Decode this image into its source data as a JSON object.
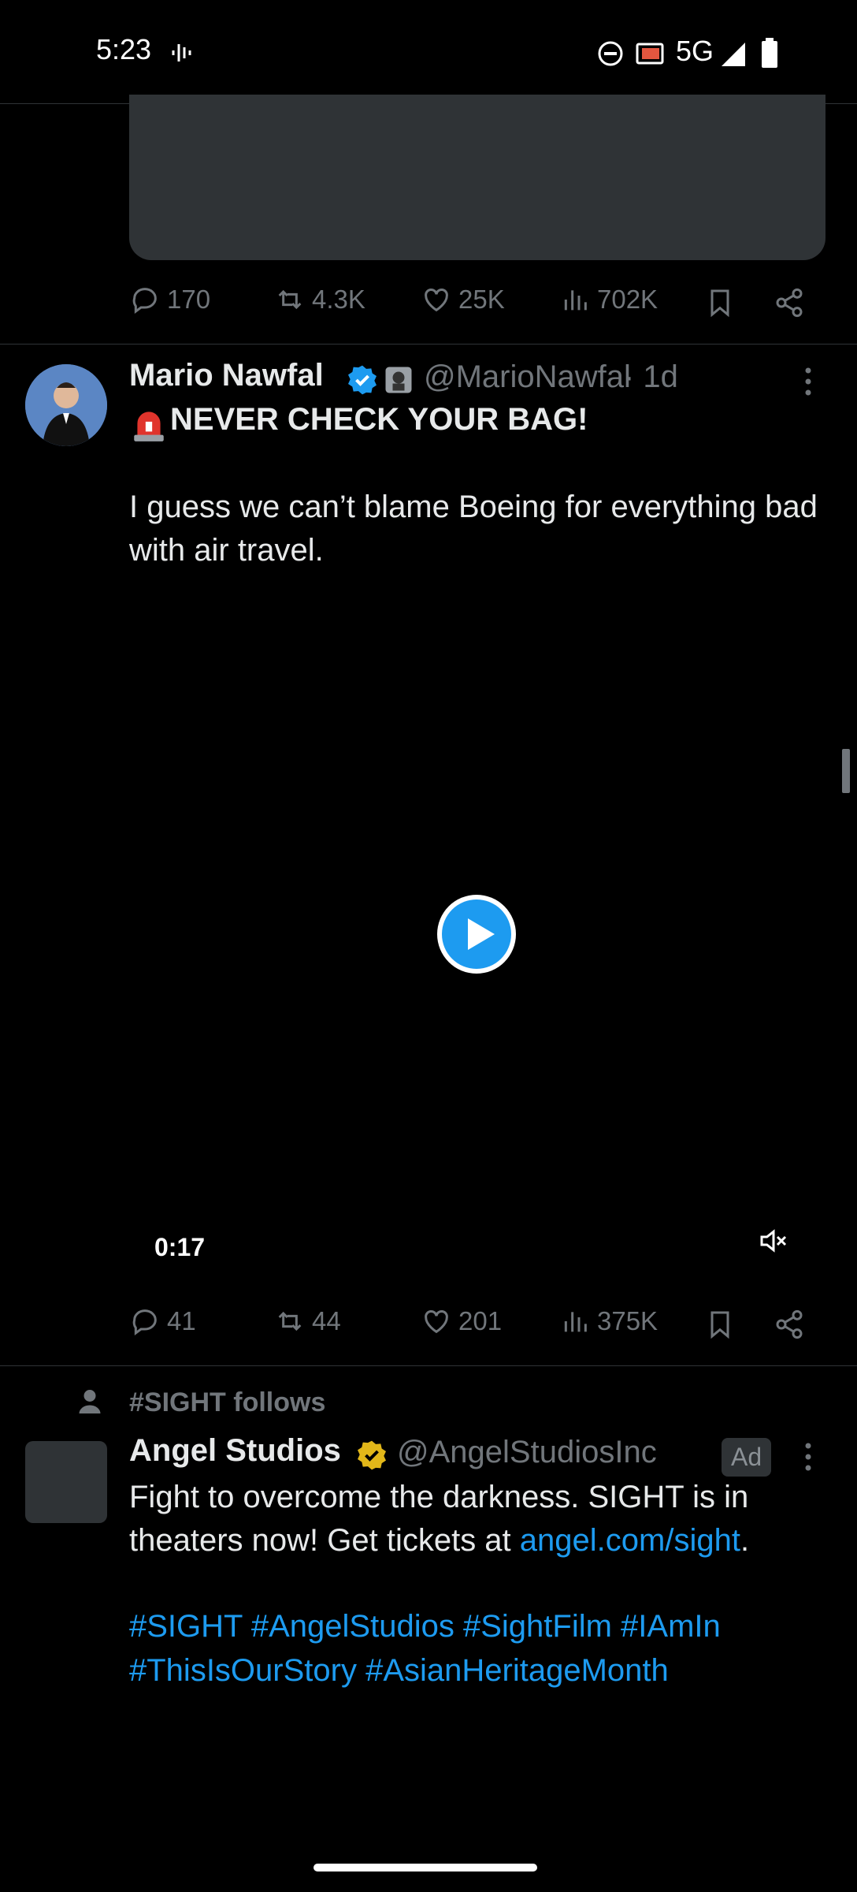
{
  "status": {
    "time": "5:23",
    "network": "5G"
  },
  "post1": {
    "replies": "170",
    "reposts": "4.3K",
    "likes": "25K",
    "views": "702K"
  },
  "post2": {
    "name": "Mario Nawfal",
    "handle": "@MarioNawfal",
    "age": "· 1d",
    "headline": "NEVER CHECK YOUR BAG!",
    "body": "I guess we can’t blame Boeing for everything bad with air travel.",
    "video_time": "0:17",
    "replies": "41",
    "reposts": "44",
    "likes": "201",
    "views": "375K"
  },
  "post3": {
    "social_context": "#SIGHT follows",
    "name": "Angel Studios",
    "handle": "@AngelStudiosInc",
    "ad_label": "Ad",
    "body_prefix": "Fight to overcome the darkness. SIGHT is in theaters now! Get tickets at",
    "link": "angel.com/sight",
    "body_suffix": ".",
    "hashtags_line1": [
      "#SIGHT",
      "#AngelStudios",
      "#SightFilm",
      "#IAmIn"
    ],
    "hashtags_line2": [
      "#ThisIsOurStory",
      "#AsianHeritageMonth"
    ]
  },
  "colors": {
    "accent": "#1d9bf0",
    "gold_badge": "#e2b719",
    "muted": "#71767b"
  }
}
